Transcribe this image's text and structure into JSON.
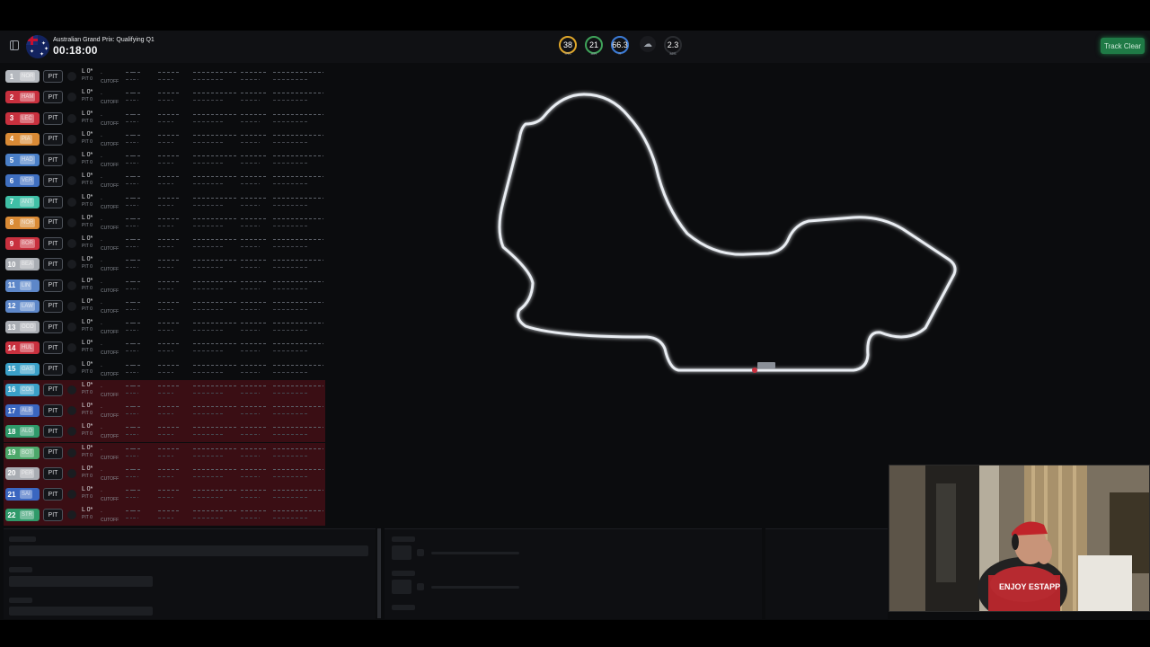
{
  "session": {
    "name": "Australian Grand Prix: Qualifying Q1",
    "clock": "00:18:00"
  },
  "weather": [
    {
      "value": "38",
      "label": "TRC",
      "color": "#e0a72a"
    },
    {
      "value": "21",
      "label": "AIR",
      "color": "#3fa35a"
    },
    {
      "value": "66.3",
      "label": "H",
      "color": "#3c7bd6"
    },
    {
      "value": "2.3",
      "label": "M/S",
      "color": "#2a2c30"
    }
  ],
  "weather_icon": "cloud-icon",
  "track_status": "Track Clear",
  "row_defaults": {
    "pit": "PIT",
    "lap": "L 0*",
    "pit_count": "PIT 0",
    "cutoff": "CUTOFF",
    "gap": "-"
  },
  "drivers": [
    {
      "pos": "1",
      "code": "NOR",
      "color": "#b5b9bf",
      "eliminated": false
    },
    {
      "pos": "2",
      "code": "HAM",
      "color": "#c8303e",
      "eliminated": false
    },
    {
      "pos": "3",
      "code": "LEC",
      "color": "#c8303e",
      "eliminated": false
    },
    {
      "pos": "4",
      "code": "PIA",
      "color": "#d98a35",
      "eliminated": false
    },
    {
      "pos": "5",
      "code": "HAD",
      "color": "#4a7fc7",
      "eliminated": false
    },
    {
      "pos": "6",
      "code": "VER",
      "color": "#3f6fc0",
      "eliminated": false
    },
    {
      "pos": "7",
      "code": "ANT",
      "color": "#3fbfa6",
      "eliminated": false
    },
    {
      "pos": "8",
      "code": "NOR",
      "color": "#d98a35",
      "eliminated": false
    },
    {
      "pos": "9",
      "code": "BOR",
      "color": "#c8303e",
      "eliminated": false
    },
    {
      "pos": "10",
      "code": "BEA",
      "color": "#a9adb3",
      "eliminated": false
    },
    {
      "pos": "11",
      "code": "LIN",
      "color": "#5d87c9",
      "eliminated": false
    },
    {
      "pos": "12",
      "code": "LAW",
      "color": "#5d87c9",
      "eliminated": false
    },
    {
      "pos": "13",
      "code": "OCO",
      "color": "#a9adb3",
      "eliminated": false
    },
    {
      "pos": "14",
      "code": "HUL",
      "color": "#c8303e",
      "eliminated": false
    },
    {
      "pos": "15",
      "code": "GAS",
      "color": "#3aa0c8",
      "eliminated": false
    },
    {
      "pos": "16",
      "code": "COL",
      "color": "#3aa0c8",
      "eliminated": true
    },
    {
      "pos": "17",
      "code": "ALB",
      "color": "#3a66c0",
      "eliminated": true
    },
    {
      "pos": "18",
      "code": "ALO",
      "color": "#2f9a6a",
      "eliminated": true
    },
    {
      "pos": "19",
      "code": "BOT",
      "color": "#4ca86a",
      "eliminated": true
    },
    {
      "pos": "20",
      "code": "PER",
      "color": "#a9adb3",
      "eliminated": true
    },
    {
      "pos": "21",
      "code": "SAI",
      "color": "#3a66c0",
      "eliminated": true
    },
    {
      "pos": "22",
      "code": "STR",
      "color": "#2f9a6a",
      "eliminated": true
    }
  ],
  "colors": {
    "accent": "#1f7a46",
    "eliminated_row": "#3a0e14",
    "track": "#e9edf2"
  }
}
